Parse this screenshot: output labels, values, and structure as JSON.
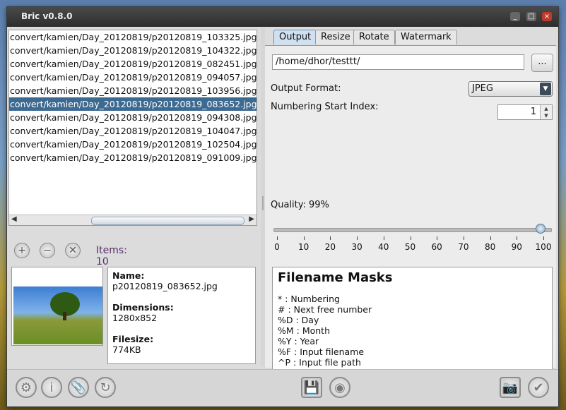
{
  "window": {
    "title": "Bric v0.8.0",
    "min_icon": "_",
    "max_icon": "□",
    "close_icon": "×"
  },
  "files": [
    "convert/kamien/Day_20120819/p20120819_103325.jpg",
    "convert/kamien/Day_20120819/p20120819_104322.jpg",
    "convert/kamien/Day_20120819/p20120819_082451.jpg",
    "convert/kamien/Day_20120819/p20120819_094057.jpg",
    "convert/kamien/Day_20120819/p20120819_103956.jpg",
    "convert/kamien/Day_20120819/p20120819_083652.jpg",
    "convert/kamien/Day_20120819/p20120819_094308.jpg",
    "convert/kamien/Day_20120819/p20120819_104047.jpg",
    "convert/kamien/Day_20120819/p20120819_102504.jpg",
    "convert/kamien/Day_20120819/p20120819_091009.jpg"
  ],
  "selected_index": 5,
  "list_tools": {
    "add_icon": "+",
    "remove_icon": "−",
    "clear_icon": "✕",
    "items_label": "Items: 10"
  },
  "file_info": {
    "name_key": "Name:",
    "name_val": "p20120819_083652.jpg",
    "dim_key": "Dimensions:",
    "dim_val": "1280x852",
    "size_key": "Filesize:",
    "size_val": "774KB"
  },
  "tabs": [
    "Output",
    "Resize",
    "Rotate",
    "Watermark"
  ],
  "active_tab": 0,
  "output": {
    "directory": "/home/dhor/testtt/",
    "browse_label": "...",
    "format_label": "Output Format:",
    "format_value": "JPEG",
    "numbering_label": "Numbering Start Index:",
    "numbering_value": "1",
    "quality_label": "Quality: 99%",
    "quality_value": 99,
    "slider_ticks": [
      "0",
      "10",
      "20",
      "30",
      "40",
      "50",
      "60",
      "70",
      "80",
      "90",
      "100"
    ]
  },
  "masks": {
    "title": "Filename Masks",
    "rows": [
      "* : Numbering",
      "# : Next free number",
      "%D : Day",
      "%M : Month",
      "%Y : Year",
      "%F : Input filename",
      "^P : Input file path"
    ]
  },
  "toolbar": {
    "settings_icon": "⚙",
    "info_icon": "i",
    "attach_icon": "📎",
    "refresh_icon": "↻",
    "save_icon": "💾",
    "disc_icon": "◉",
    "camera_icon": "📷",
    "ok_icon": "✔"
  }
}
